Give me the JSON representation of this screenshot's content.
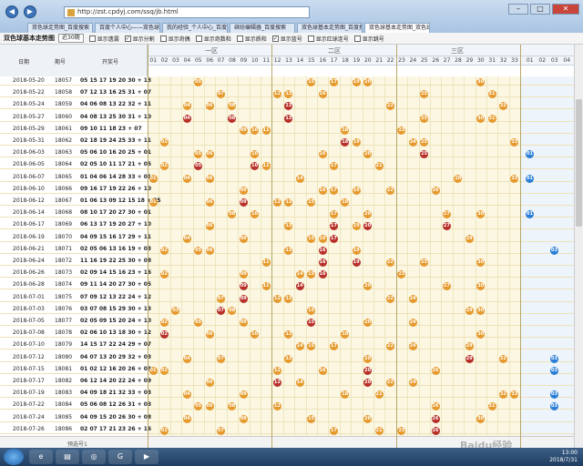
{
  "browser": {
    "address": "http://zst.cpdyj.com/ssq/jb.html",
    "tabs": [
      "双色球走势图_百度搜索",
      "百度个人中心——双色球",
      "我的经验_个人中心_百度经验",
      "缤纷编辑器_百度搜索",
      "双色球基本走势图_百度搜索",
      "双色球基本走势图_双色球"
    ],
    "window_buttons": [
      "–",
      "□",
      "✕"
    ]
  },
  "controls": {
    "title": "双色球基本走势图",
    "period_select": "近30期",
    "options": [
      {
        "label": "显示遗漏",
        "checked": false
      },
      {
        "label": "显示分割",
        "checked": true
      },
      {
        "label": "显示奇偶",
        "checked": false
      },
      {
        "label": "显示奇数和",
        "checked": false
      },
      {
        "label": "显示质和",
        "checked": false
      },
      {
        "label": "显示蓝号",
        "checked": true
      },
      {
        "label": "显示红球连号",
        "checked": false
      },
      {
        "label": "显示跳号",
        "checked": false
      }
    ]
  },
  "table": {
    "headers": {
      "date": "日期",
      "issue": "期号",
      "numbers": "开奖号",
      "zone1": "一区",
      "zone2": "二区",
      "zone3": "三区"
    },
    "red_cols": [
      "01",
      "02",
      "03",
      "04",
      "05",
      "06",
      "07",
      "08",
      "09",
      "10",
      "11",
      "12",
      "13",
      "14",
      "15",
      "16",
      "17",
      "18",
      "19",
      "20",
      "21",
      "22",
      "23",
      "24",
      "25",
      "26",
      "27",
      "28",
      "29",
      "30",
      "31",
      "32",
      "33"
    ],
    "blue_cols": [
      "01",
      "02",
      "03",
      "04"
    ],
    "rows": [
      {
        "date": "2018-05-20",
        "issue": "18057",
        "nums": "05 15 17 19 20 30 + 13"
      },
      {
        "date": "2018-05-22",
        "issue": "18058",
        "nums": "07 12 13 16 25 31 + 07"
      },
      {
        "date": "2018-05-24",
        "issue": "18059",
        "nums": "04 06 08 13 22 32 + 11"
      },
      {
        "date": "2018-05-27",
        "issue": "18060",
        "nums": "04 08 13 25 30 31 + 10"
      },
      {
        "date": "2018-05-29",
        "issue": "18061",
        "nums": "09 10 11 18 23 + 07"
      },
      {
        "date": "2018-05-31",
        "issue": "18062",
        "nums": "02 18 19 24 25 33 + 11"
      },
      {
        "date": "2018-06-03",
        "issue": "18063",
        "nums": "05 06 10 16 20 25 + 01"
      },
      {
        "date": "2018-06-05",
        "issue": "18064",
        "nums": "02 05 10 11 17 21 + 05"
      },
      {
        "date": "2018-06-07",
        "issue": "18065",
        "nums": "01 04 06 14 28 33 + 01"
      },
      {
        "date": "2018-06-10",
        "issue": "18066",
        "nums": "09 16 17 19 22 26 + 10"
      },
      {
        "date": "2018-06-12",
        "issue": "18067",
        "nums": "01 06 13 09 12 15 18 + 05"
      },
      {
        "date": "2018-06-14",
        "issue": "18068",
        "nums": "08 10 17 20 27 30 + 01"
      },
      {
        "date": "2018-06-17",
        "issue": "18069",
        "nums": "06 13 17 19 20 27 + 10"
      },
      {
        "date": "2018-06-19",
        "issue": "18070",
        "nums": "04 09 15 16 17 29 + 11"
      },
      {
        "date": "2018-06-21",
        "issue": "18071",
        "nums": "02 05 06 13 16 19 + 03"
      },
      {
        "date": "2018-06-24",
        "issue": "18072",
        "nums": "11 16 19 22 25 30 + 08"
      },
      {
        "date": "2018-06-26",
        "issue": "18073",
        "nums": "02 09 14 15 16 23 + 16"
      },
      {
        "date": "2018-06-28",
        "issue": "18074",
        "nums": "09 11 14 20 27 30 + 05"
      },
      {
        "date": "2018-07-01",
        "issue": "18075",
        "nums": "07 09 12 13 22 24 + 12"
      },
      {
        "date": "2018-07-03",
        "issue": "18076",
        "nums": "03 07 08 15 29 30 + 13"
      },
      {
        "date": "2018-07-05",
        "issue": "18077",
        "nums": "02 05 09 15 20 24 + 10"
      },
      {
        "date": "2018-07-08",
        "issue": "18078",
        "nums": "02 06 10 13 18 30 + 12"
      },
      {
        "date": "2018-07-10",
        "issue": "18079",
        "nums": "14 15 17 22 24 29 + 07"
      },
      {
        "date": "2018-07-12",
        "issue": "18080",
        "nums": "04 07 13 20 29 32 + 03"
      },
      {
        "date": "2018-07-15",
        "issue": "18081",
        "nums": "01 02 12 16 20 26 + 03"
      },
      {
        "date": "2018-07-17",
        "issue": "18082",
        "nums": "06 12 14 20 22 24 + 09"
      },
      {
        "date": "2018-07-19",
        "issue": "18083",
        "nums": "04 09 18 21 32 33 + 03"
      },
      {
        "date": "2018-07-22",
        "issue": "18084",
        "nums": "05 06 08 12 26 31 + 03"
      },
      {
        "date": "2018-07-24",
        "issue": "18085",
        "nums": "04 09 15 20 26 30 + 08"
      },
      {
        "date": "2018-07-26",
        "issue": "18086",
        "nums": "02 07 17 21 23 26 + 16"
      }
    ],
    "footer_label": "预选号1"
  },
  "watermark": "Baidu经验",
  "taskbar": {
    "clock_time": "13:00",
    "clock_date": "2018/7/31"
  }
}
